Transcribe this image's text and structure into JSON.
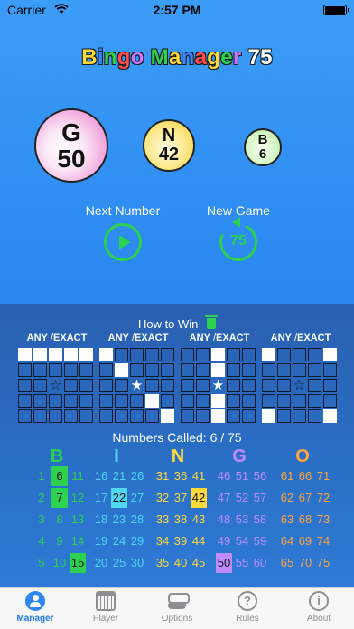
{
  "status_bar": {
    "carrier": "Carrier",
    "time": "2:57 PM"
  },
  "title": {
    "parts": [
      {
        "text": "Bingo",
        "colors": [
          "#ffd83a",
          "#3a86ff",
          "#2bd14f",
          "#ff4d4d",
          "#c877ff"
        ]
      },
      {
        "text": "Manager",
        "colors": [
          "#2bd14f",
          "#ffd83a",
          "#3a86ff",
          "#ff4d4d",
          "#ffd83a",
          "#2bd14f",
          "#c877ff"
        ]
      },
      {
        "text": "75",
        "colors": [
          "#ffffff",
          "#ffffff"
        ]
      }
    ]
  },
  "balls": {
    "current": {
      "letter": "G",
      "number": "50"
    },
    "previous_1": {
      "letter": "N",
      "number": "42"
    },
    "previous_2": {
      "letter": "B",
      "number": "6"
    }
  },
  "controls": {
    "next_label": "Next Number",
    "new_game_label": "New Game",
    "new_game_badge": "75"
  },
  "how_to_win": {
    "label": "How to Win",
    "patterns": [
      {
        "any": "ANY",
        "sep": "/",
        "exact": "EXACT",
        "exact_active": false,
        "grid": [
          [
            1,
            1,
            1,
            1,
            1
          ],
          [
            0,
            0,
            0,
            0,
            0
          ],
          [
            0,
            0,
            0,
            0,
            0
          ],
          [
            0,
            0,
            0,
            0,
            0
          ],
          [
            0,
            0,
            0,
            0,
            0
          ]
        ]
      },
      {
        "any": "ANY",
        "sep": "/",
        "exact": "EXACT",
        "exact_active": false,
        "grid": [
          [
            1,
            0,
            0,
            0,
            0
          ],
          [
            0,
            1,
            0,
            0,
            0
          ],
          [
            0,
            0,
            1,
            0,
            0
          ],
          [
            0,
            0,
            0,
            1,
            0
          ],
          [
            0,
            0,
            0,
            0,
            1
          ]
        ]
      },
      {
        "any": "ANY",
        "sep": "/",
        "exact": "EXACT",
        "exact_active": false,
        "grid": [
          [
            0,
            0,
            1,
            0,
            0
          ],
          [
            0,
            0,
            1,
            0,
            0
          ],
          [
            0,
            0,
            1,
            0,
            0
          ],
          [
            0,
            0,
            1,
            0,
            0
          ],
          [
            0,
            0,
            1,
            0,
            0
          ]
        ]
      },
      {
        "any": "ANY",
        "sep": "/",
        "exact": "EXACT",
        "exact_active": true,
        "grid": [
          [
            1,
            0,
            0,
            0,
            1
          ],
          [
            0,
            0,
            0,
            0,
            0
          ],
          [
            0,
            0,
            0,
            0,
            0
          ],
          [
            0,
            0,
            0,
            0,
            0
          ],
          [
            1,
            0,
            0,
            0,
            1
          ]
        ]
      }
    ]
  },
  "numbers_called": {
    "label": "Numbers Called:",
    "count": "6 / 75"
  },
  "board": {
    "letters": [
      {
        "letter": "B",
        "color": "#2bd14f"
      },
      {
        "letter": "I",
        "color": "#4fd8ef"
      },
      {
        "letter": "N",
        "color": "#ffd83a"
      },
      {
        "letter": "G",
        "color": "#c08cff"
      },
      {
        "letter": "O",
        "color": "#ffa53a"
      }
    ],
    "columns": [
      {
        "color": "#2bd14f",
        "rows": [
          [
            "1",
            "6",
            "11"
          ],
          [
            "2",
            "7",
            "12"
          ],
          [
            "3",
            "8",
            "13"
          ],
          [
            "4",
            "9",
            "14"
          ],
          [
            "5",
            "10",
            "15"
          ]
        ]
      },
      {
        "color": "#4fd8ef",
        "rows": [
          [
            "16",
            "21",
            "26"
          ],
          [
            "17",
            "22",
            "27"
          ],
          [
            "18",
            "23",
            "28"
          ],
          [
            "19",
            "24",
            "29"
          ],
          [
            "20",
            "25",
            "30"
          ]
        ]
      },
      {
        "color": "#ffd83a",
        "rows": [
          [
            "31",
            "36",
            "41"
          ],
          [
            "32",
            "37",
            "42"
          ],
          [
            "33",
            "38",
            "43"
          ],
          [
            "34",
            "39",
            "44"
          ],
          [
            "35",
            "40",
            "45"
          ]
        ]
      },
      {
        "color": "#c08cff",
        "rows": [
          [
            "46",
            "51",
            "56"
          ],
          [
            "47",
            "52",
            "57"
          ],
          [
            "48",
            "53",
            "58"
          ],
          [
            "49",
            "54",
            "59"
          ],
          [
            "50",
            "55",
            "60"
          ]
        ]
      },
      {
        "color": "#ffa53a",
        "rows": [
          [
            "61",
            "66",
            "71"
          ],
          [
            "62",
            "67",
            "72"
          ],
          [
            "63",
            "68",
            "73"
          ],
          [
            "64",
            "69",
            "74"
          ],
          [
            "65",
            "70",
            "75"
          ]
        ]
      }
    ],
    "called": [
      "6",
      "7",
      "15",
      "22",
      "42",
      "50"
    ]
  },
  "tabs": [
    {
      "label": "Manager",
      "icon": "person-icon",
      "active": true
    },
    {
      "label": "Player",
      "icon": "bingo-card-icon",
      "active": false
    },
    {
      "label": "Options",
      "icon": "toggle-icon",
      "active": false
    },
    {
      "label": "Rules",
      "icon": "question-icon",
      "active": false
    },
    {
      "label": "About",
      "icon": "info-icon",
      "active": false
    }
  ],
  "colors": {
    "accent_green": "#2bd14f",
    "top_background": "#2a86f0",
    "bottom_background": "#2a5fb0",
    "tab_active": "#1f7ae8"
  }
}
